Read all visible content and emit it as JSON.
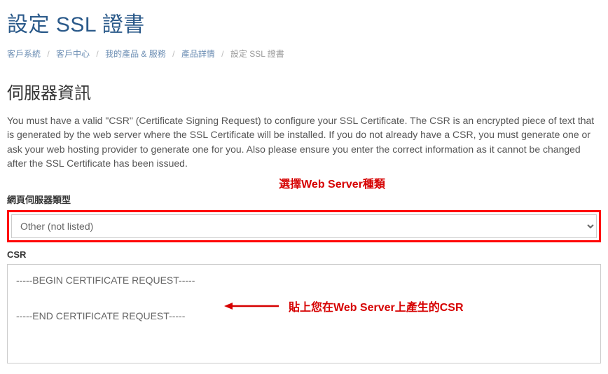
{
  "page_title": "設定 SSL 證書",
  "breadcrumb": {
    "items": [
      "客戶系統",
      "客戶中心",
      "我的產品 & 服務",
      "產品詳情"
    ],
    "current": "設定 SSL 證書"
  },
  "section_title": "伺服器資訊",
  "description": "You must have a valid \"CSR\" (Certificate Signing Request) to configure your SSL Certificate. The CSR is an encrypted piece of text that is generated by the web server where the SSL Certificate will be installed. If you do not already have a CSR, you must generate one or ask your web hosting provider to generate one for you. Also please ensure you enter the correct information as it cannot be changed after the SSL Certificate has been issued.",
  "annotations": {
    "select_label": "選擇Web Server種類",
    "csr_label": "貼上您在Web Server上產生的CSR"
  },
  "server_type": {
    "label": "網頁伺服器類型",
    "selected": "Other (not listed)"
  },
  "csr": {
    "label": "CSR",
    "value": "-----BEGIN CERTIFICATE REQUEST-----\n\n-----END CERTIFICATE REQUEST-----"
  }
}
